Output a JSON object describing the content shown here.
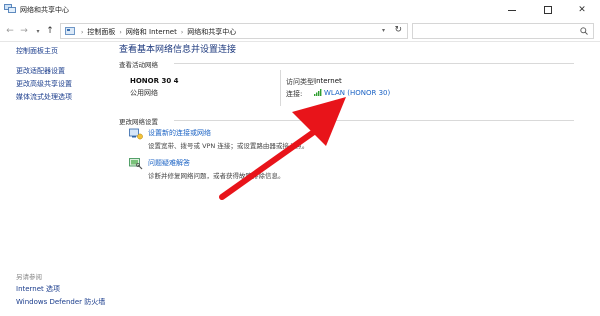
{
  "window": {
    "title": "网络和共享中心"
  },
  "address": {
    "crumbs": [
      "控制面板",
      "网络和 Internet",
      "网络和共享中心"
    ],
    "search_placeholder": ""
  },
  "left_nav": {
    "links": [
      "控制面板主页",
      "更改适配器设置",
      "更改高级共享设置",
      "媒体流式处理选项"
    ],
    "see_also_label": "另请参阅",
    "see_also_links": [
      "Internet 选项",
      "Windows Defender 防火墙"
    ]
  },
  "main": {
    "title": "查看基本网络信息并设置连接",
    "active_networks_label": "查看活动网络",
    "network": {
      "name": "HONOR 30 4",
      "type": "公用网络",
      "access_type_label": "访问类型:",
      "access_type_value": "Internet",
      "connection_label": "连接:",
      "connection_value": "WLAN (HONOR 30)"
    },
    "change_settings_label": "更改网络设置",
    "tasks": [
      {
        "link": "设置新的连接或网络",
        "desc": "设置宽带、拨号或 VPN 连接；或设置路由器或接入点。",
        "icon": "network-setup-icon"
      },
      {
        "link": "问题疑难解答",
        "desc": "诊断并修复网络问题，或者获得故障排除信息。",
        "icon": "troubleshoot-icon"
      }
    ]
  },
  "annotation": {
    "arrow_color": "#e8141a"
  }
}
